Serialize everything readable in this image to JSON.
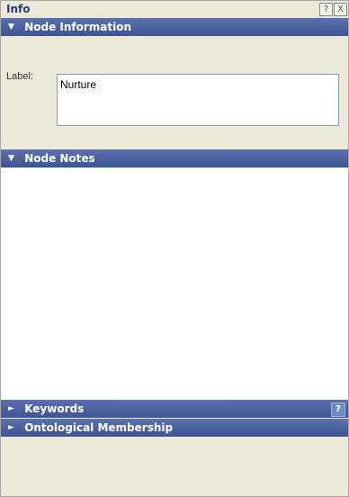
{
  "window": {
    "title": "Info",
    "help_label": "?",
    "close_label": "X"
  },
  "node_information": {
    "header": "Node Information",
    "expanded_arrow": "▼",
    "label_caption": "Label:",
    "label_value": "Nurture"
  },
  "node_notes": {
    "header": "Node Notes",
    "expanded_arrow": "▼",
    "content": ""
  },
  "keywords": {
    "header": "Keywords",
    "collapsed_arrow": "►",
    "help_label": "?"
  },
  "ontological_membership": {
    "header": "Ontological Membership",
    "collapsed_arrow": "►"
  },
  "colors": {
    "header_bg": "#4a62a2",
    "panel_bg": "#ece9d8",
    "title_text": "#2a3c78"
  }
}
